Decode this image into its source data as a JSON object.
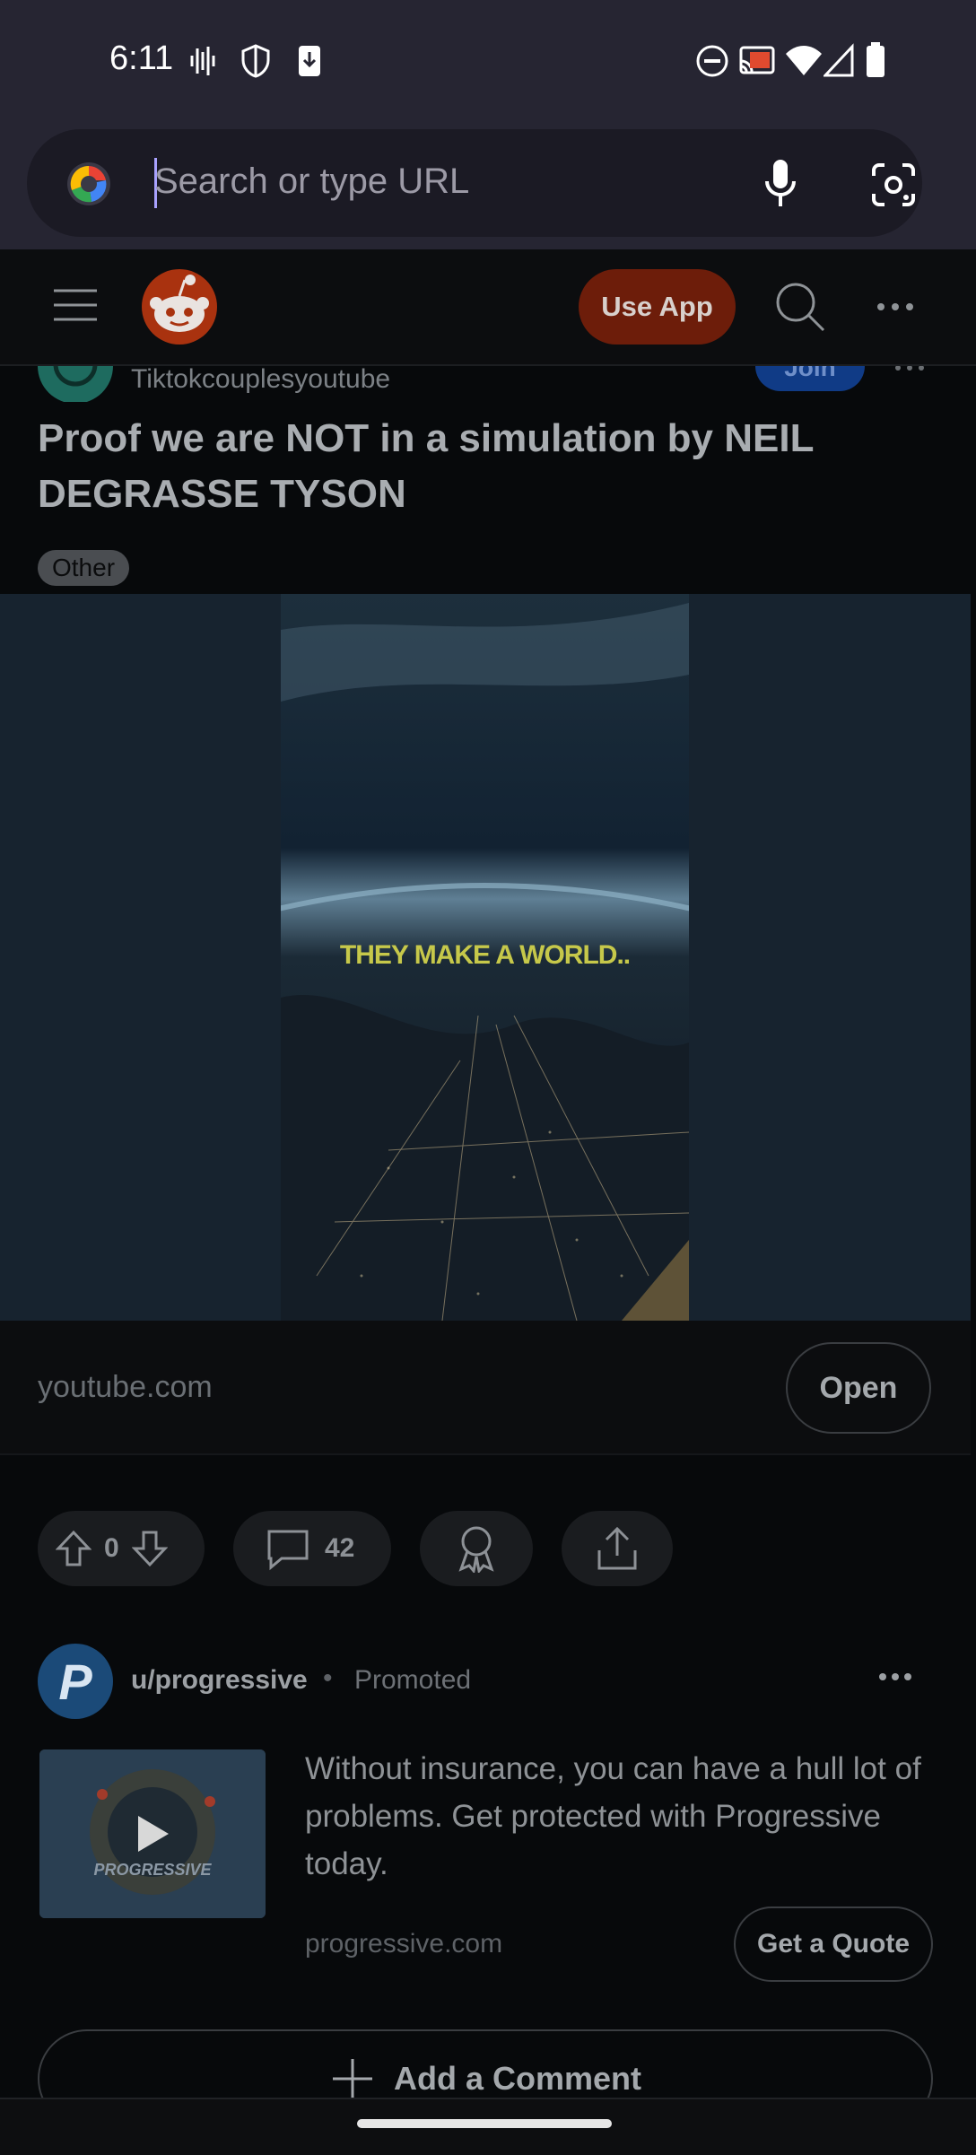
{
  "status_bar": {
    "time": "6:11"
  },
  "browser": {
    "url_placeholder": "Search or type URL"
  },
  "reddit_header": {
    "use_app_label": "Use App"
  },
  "post": {
    "subreddit": "Tiktokcouplesyoutube",
    "join_label": "Join",
    "title": "Proof we are NOT in a simulation by NEIL DEGRASSE TYSON",
    "flair": "Other",
    "video_caption": "THEY MAKE A WORLD..",
    "link_domain": "youtube.com",
    "open_label": "Open",
    "vote_count": "0",
    "comment_count": "42"
  },
  "ad": {
    "user": "u/progressive",
    "separator": "•",
    "promoted_label": "Promoted",
    "thumb_brand": "PROGRESSIVE",
    "body": "Without insurance, you can have a hull lot of problems. Get protected with Progressive today.",
    "domain": "progressive.com",
    "cta_label": "Get a Quote"
  },
  "comment": {
    "add_label": "Add a Comment"
  }
}
